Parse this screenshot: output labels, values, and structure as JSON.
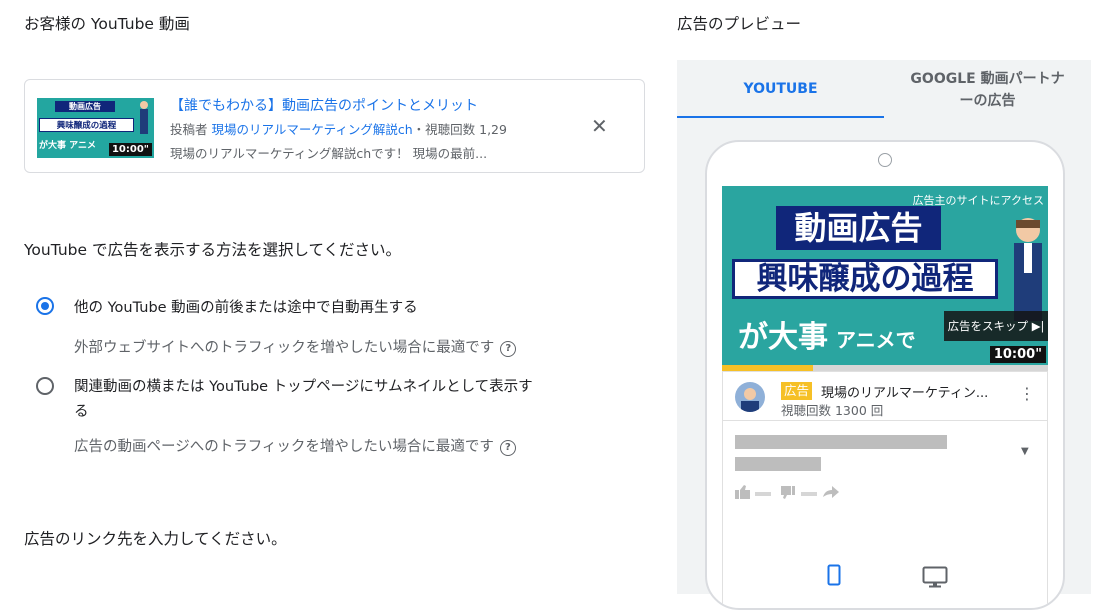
{
  "left": {
    "video_heading": "お客様の YouTube 動画",
    "video": {
      "title": "【誰でもわかる】動画広告のポイントとメリット",
      "meta_prefix": "投稿者 ",
      "channel": "現場のリアルマーケティング解説ch",
      "meta_suffix": "・視聴回数 1,29",
      "description": "現場のリアルマーケティング解説chです！ 現場の最前...",
      "thumb_line1": "動画広告",
      "thumb_line2": "興味醸成の過程",
      "thumb_line3": "が大事 アニメ",
      "duration": "10:00\"",
      "close_icon": "close-icon"
    },
    "method_heading": "YouTube で広告を表示する方法を選択してください。",
    "options": [
      {
        "label": "他の YouTube 動画の前後または途中で自動再生する",
        "hint": "外部ウェブサイトへのトラフィックを増やしたい場合に最適です",
        "selected": true
      },
      {
        "label_line1": "関連動画の横または YouTube トップページにサムネイルとして表示す",
        "label_line2": "る",
        "hint": "広告の動画ページへのトラフィックを増やしたい場合に最適です",
        "selected": false
      }
    ],
    "link_heading": "広告のリンク先を入力してください。"
  },
  "preview": {
    "heading": "広告のプレビュー",
    "tabs": [
      {
        "label": "YOUTUBE",
        "active": true
      },
      {
        "label_line1": "GOOGLE 動画パートナ",
        "label_line2": "ーの広告",
        "active": false
      }
    ],
    "ad": {
      "top_text": "広告主のサイトにアクセス",
      "line1": "動画広告",
      "line2": "興味醸成の過程",
      "line3": "が大事",
      "line3_small": "アニメで",
      "skip_label": "広告をスキップ ▶|",
      "duration": "10:00\"",
      "progress": 0.28
    },
    "info": {
      "badge": "広告",
      "channel": "現場のリアルマーケティン...",
      "views": "視聴回数 1300 回"
    },
    "devices": [
      "mobile-icon",
      "desktop-icon"
    ]
  },
  "colors": {
    "accent": "#1a73e8",
    "panel_bg": "#f1f3f4",
    "badge": "#f6c026",
    "thumb_teal": "#2aa5a0",
    "thumb_navy": "#10267a"
  }
}
